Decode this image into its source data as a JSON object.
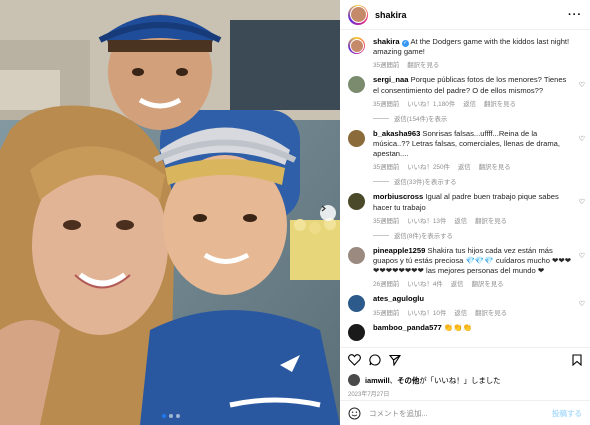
{
  "header": {
    "username": "shakira"
  },
  "caption": {
    "username": "shakira",
    "text": "At the Dodgers game with the kiddos last night! amazing game!",
    "time": "35週間前",
    "translate": "翻訳を見る"
  },
  "comments": [
    {
      "username": "sergi_naa",
      "text": "Porque públicas fotos de los menores? Tienes el consentimiento del padre? O de ellos mismos??",
      "time": "35週間前",
      "likes": "いいね！1,180件",
      "reply": "返信",
      "translate": "翻訳を見る",
      "replies_label": "返信(154件)を表示",
      "avatar_color": "#7b8b6e"
    },
    {
      "username": "b_akasha963",
      "text": "Sonrisas falsas...uffff...Reina de la música..?? Letras falsas, comerciales, llenas de drama, apestan....",
      "time": "35週間前",
      "likes": "いいね！250件",
      "reply": "返信",
      "translate": "翻訳を見る",
      "replies_label": "返信(33件)を表示する",
      "avatar_color": "#8b6b3a"
    },
    {
      "username": "morbiuscross",
      "text": "Igual al padre buen trabajo pique sabes hacer tu trabajo",
      "time": "35週間前",
      "likes": "いいね！13件",
      "reply": "返信",
      "translate": "翻訳を見る",
      "replies_label": "返信(8件)を表示する",
      "avatar_color": "#4a4a2a"
    },
    {
      "username": "pineapple1259",
      "text": "Shakira tus hijos cada vez están más guapos y tú estás preciosa 💎💎💎 cuídaros mucho ❤❤❤❤❤❤❤❤❤❤❤ las mejores personas del mundo ❤",
      "time": "26週間前",
      "likes": "いいね！4件",
      "reply": "返信",
      "translate": "翻訳を見る",
      "avatar_color": "#9a8a80"
    },
    {
      "username": "ates_aguloglu",
      "text": "",
      "time": "35週間前",
      "likes": "いいね！10件",
      "reply": "返信",
      "translate": "翻訳を見る",
      "avatar_color": "#2c5a8a"
    },
    {
      "username": "bamboo_panda577",
      "text": "👏👏👏",
      "time": "",
      "likes": "",
      "reply": "",
      "translate": "",
      "avatar_color": "#1a1a1a"
    }
  ],
  "likes": {
    "user": "iamwill",
    "mid": "、",
    "others": "その他",
    "suffix": "が「いいね！」しました"
  },
  "date": "2023年7月27日",
  "add_comment": {
    "placeholder": "コメントを追加...",
    "post_label": "投稿する"
  }
}
